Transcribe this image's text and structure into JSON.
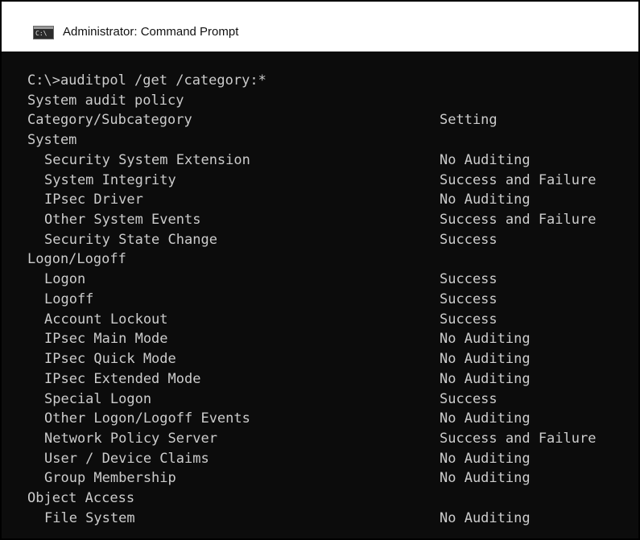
{
  "window": {
    "title": "Administrator: Command Prompt",
    "icon": "command-prompt-icon",
    "icon_text": "C:\\",
    "background": "#0c0c0c",
    "text_color": "#cccccc"
  },
  "console": {
    "command": "C:\\>auditpol /get /category:*",
    "heading": "System audit policy",
    "column_header": {
      "name": "Category/Subcategory",
      "setting": "Setting"
    },
    "rows": [
      {
        "name": "System",
        "setting": "",
        "indent": false
      },
      {
        "name": "Security System Extension",
        "setting": "No Auditing",
        "indent": true
      },
      {
        "name": "System Integrity",
        "setting": "Success and Failure",
        "indent": true
      },
      {
        "name": "IPsec Driver",
        "setting": "No Auditing",
        "indent": true
      },
      {
        "name": "Other System Events",
        "setting": "Success and Failure",
        "indent": true
      },
      {
        "name": "Security State Change",
        "setting": "Success",
        "indent": true
      },
      {
        "name": "Logon/Logoff",
        "setting": "",
        "indent": false
      },
      {
        "name": "Logon",
        "setting": "Success",
        "indent": true
      },
      {
        "name": "Logoff",
        "setting": "Success",
        "indent": true
      },
      {
        "name": "Account Lockout",
        "setting": "Success",
        "indent": true
      },
      {
        "name": "IPsec Main Mode",
        "setting": "No Auditing",
        "indent": true
      },
      {
        "name": "IPsec Quick Mode",
        "setting": "No Auditing",
        "indent": true
      },
      {
        "name": "IPsec Extended Mode",
        "setting": "No Auditing",
        "indent": true
      },
      {
        "name": "Special Logon",
        "setting": "Success",
        "indent": true
      },
      {
        "name": "Other Logon/Logoff Events",
        "setting": "No Auditing",
        "indent": true
      },
      {
        "name": "Network Policy Server",
        "setting": "Success and Failure",
        "indent": true
      },
      {
        "name": "User / Device Claims",
        "setting": "No Auditing",
        "indent": true
      },
      {
        "name": "Group Membership",
        "setting": "No Auditing",
        "indent": true
      },
      {
        "name": "Object Access",
        "setting": "",
        "indent": false
      },
      {
        "name": "File System",
        "setting": "No Auditing",
        "indent": true
      }
    ]
  }
}
